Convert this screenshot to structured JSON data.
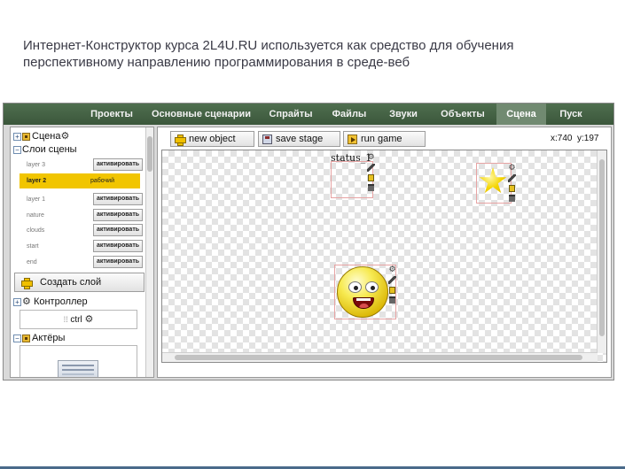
{
  "caption": {
    "line1": "Интернет-Конструктор курса 2L4U.RU используется как средство для  обучения",
    "line2": "перспективному направлению программирования в среде-веб"
  },
  "menu": {
    "items": [
      "Проекты",
      "Основные сценарии",
      "Спрайты",
      "Файлы",
      "Звуки",
      "Объекты",
      "Сцена",
      "Пуск"
    ],
    "active": "Сцена"
  },
  "tree": {
    "scene_toggle": "+",
    "scene_label": "Сцена",
    "layers_toggle": "−",
    "layers_label": "Слои сцены",
    "controllers_toggle": "+",
    "controllers_label": "Контроллер",
    "actors_toggle": "−",
    "actors_label": "Актёры"
  },
  "layers": [
    {
      "name": "layer 3",
      "state": "",
      "button": "активировать",
      "active": false
    },
    {
      "name": "layer 2",
      "state": "рабочий",
      "button": "",
      "active": true
    },
    {
      "name": "layer 1",
      "state": "",
      "button": "активировать",
      "active": false
    },
    {
      "name": "nature",
      "state": "",
      "button": "активировать",
      "active": false
    },
    {
      "name": "clouds",
      "state": "",
      "button": "активировать",
      "active": false
    },
    {
      "name": "start",
      "state": "",
      "button": "активировать",
      "active": false
    },
    {
      "name": "end",
      "state": "",
      "button": "активировать",
      "active": false
    }
  ],
  "create_layer_label": "Создать слой",
  "controller_item": "ctrl",
  "toolbar": {
    "new_object": "new object",
    "save_stage": "save stage",
    "run_game": "run game"
  },
  "coords": {
    "x": "x:740",
    "y": "y:197"
  },
  "stage": {
    "status_label": "status_1"
  },
  "icons": [
    "plus-icon",
    "save-icon",
    "run-icon",
    "gear-icon",
    "pencil-icon",
    "layer-up-icon",
    "trash-icon"
  ],
  "colors": {
    "menubar": "#44624a",
    "active_layer": "#f1c500",
    "sprite_border": "#e7a4a4"
  }
}
